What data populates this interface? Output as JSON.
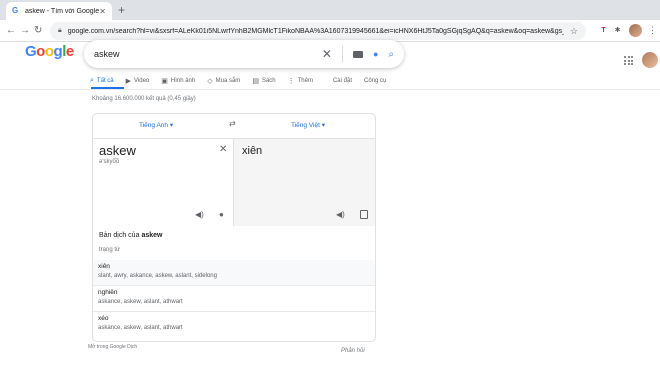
{
  "browser": {
    "tab_title": "askew - Tìm với Google",
    "tab_favicon": "G",
    "new_tab": "+",
    "url": "google.com.vn/search?hl=vi&sxsrf=ALeKk01i5NLwrfYnhB2MGMlcT1FikoNBAA%3A1607319945661&ei=icHNX6HtJ5Ta0gSGjqSgAQ&q=askew&oq=askew&gs_lcp=CgZwc3..."
  },
  "google": {
    "logo": [
      "G",
      "o",
      "o",
      "g",
      "l",
      "e"
    ],
    "logo_colors": [
      "#4285f4",
      "#ea4335",
      "#fbbc05",
      "#4285f4",
      "#34a853",
      "#ea4335"
    ],
    "query": "askew",
    "tabs": [
      {
        "icon": "search-icon",
        "glyph": "⌕",
        "label": "Tất cả",
        "active": true
      },
      {
        "icon": "video-icon",
        "glyph": "▶",
        "label": "Video"
      },
      {
        "icon": "image-icon",
        "glyph": "▣",
        "label": "Hình ảnh"
      },
      {
        "icon": "tag-icon",
        "glyph": "◇",
        "label": "Mua sắm"
      },
      {
        "icon": "book-icon",
        "glyph": "▤",
        "label": "Sách"
      },
      {
        "icon": "more-icon",
        "glyph": "⋮",
        "label": "Thêm"
      }
    ],
    "settings": "Cài đặt",
    "tools": "Công cụ",
    "result_stats": "Khoảng 16.600.000 kết quả (0,45 giây)"
  },
  "translate": {
    "source_lang": "Tiếng Anh",
    "target_lang": "Tiếng Việt",
    "source_word": "askew",
    "phonetic": "ə'skyo͞o",
    "target_word": "xiên",
    "translations_of_prefix": "Bản dịch của",
    "translations_of_word": "askew",
    "part_of_speech": "trạng từ",
    "entries": [
      {
        "word": "xiên",
        "synonyms": "slant, awry, askance, askew, aslant, sidelong"
      },
      {
        "word": "nghiên",
        "synonyms": "askance, askew, aslant, athwart"
      },
      {
        "word": "xéo",
        "synonyms": "askance, askew, aslant, athwart"
      }
    ],
    "opened_in": "Mở trong Google Dịch",
    "feedback": "Phản hồi"
  }
}
